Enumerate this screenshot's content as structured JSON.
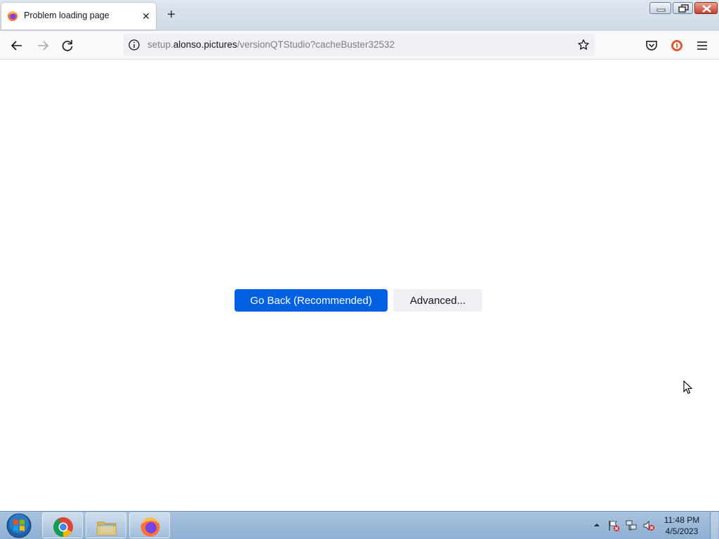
{
  "browser": {
    "tab": {
      "title": "Problem loading page",
      "close_glyph": "✕"
    },
    "new_tab_glyph": "+",
    "url": {
      "prefix": "setup.",
      "host": "alonso.pictures",
      "path": "/versionQTStudio?cacheBuster32532"
    }
  },
  "page": {
    "buttons": {
      "go_back": "Go Back (Recommended)",
      "advanced": "Advanced..."
    },
    "colors": {
      "primary": "#0061e0",
      "secondary": "#f0f0f4"
    }
  },
  "taskbar": {
    "apps": [
      "chrome-icon",
      "file-explorer-icon",
      "firefox-icon"
    ],
    "clock": {
      "time": "11:48 PM",
      "date": "4/5/2023"
    }
  }
}
